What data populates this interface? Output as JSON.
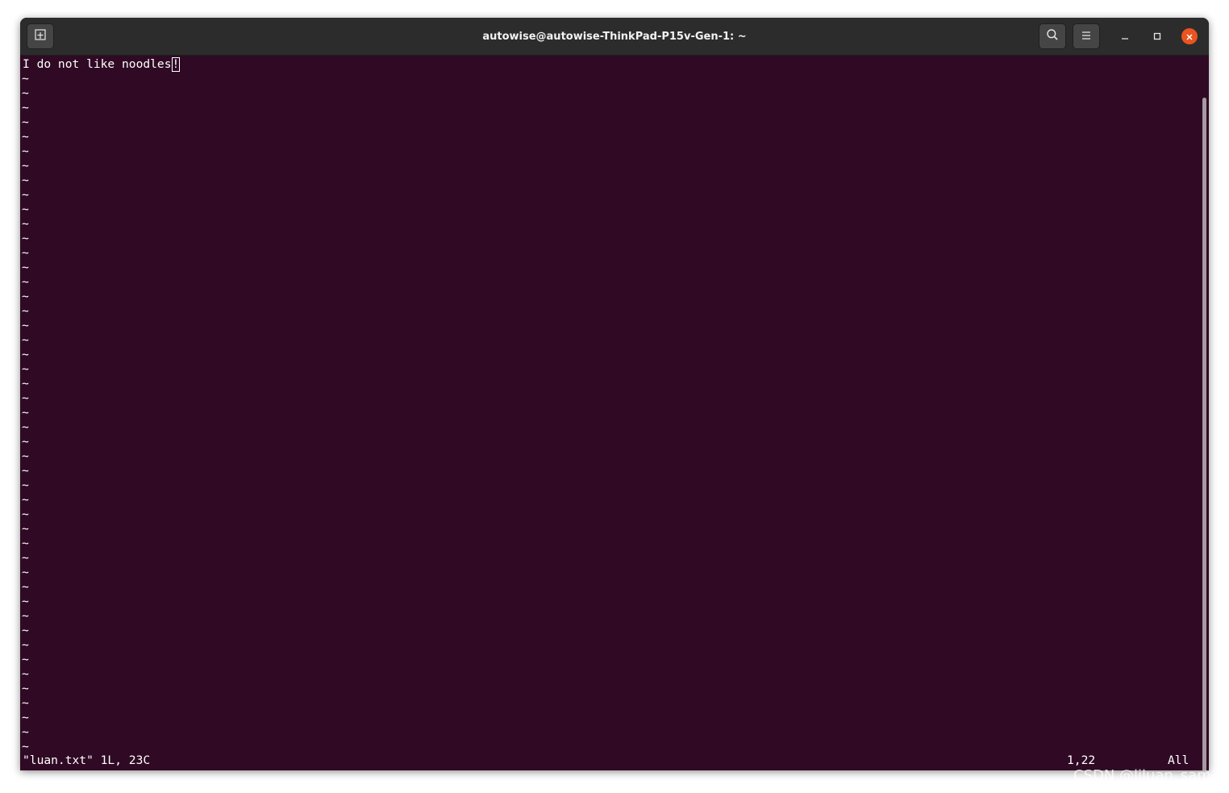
{
  "window": {
    "title": "autowise@autowise-ThinkPad-P15v-Gen-1: ~"
  },
  "header": {
    "new_tab_icon": "new-tab-icon",
    "search_icon": "search-icon",
    "menu_icon": "hamburger-menu-icon",
    "minimize_icon": "minimize-icon",
    "maximize_icon": "maximize-icon",
    "close_icon": "close-icon"
  },
  "editor": {
    "lines": [
      "I do not like noodles"
    ],
    "cursor_char": "!",
    "empty_line_marker": "~",
    "empty_line_count": 47
  },
  "status": {
    "file_info": "\"luan.txt\" 1L, 23C",
    "cursor_position": "1,22",
    "scroll_position": "All"
  },
  "watermark": {
    "text": "CSDN @liluan_sam"
  },
  "colors": {
    "terminal_background": "#300a24",
    "titlebar": "#2c2c2c",
    "close_button": "#e95420",
    "text": "#ffffff"
  }
}
